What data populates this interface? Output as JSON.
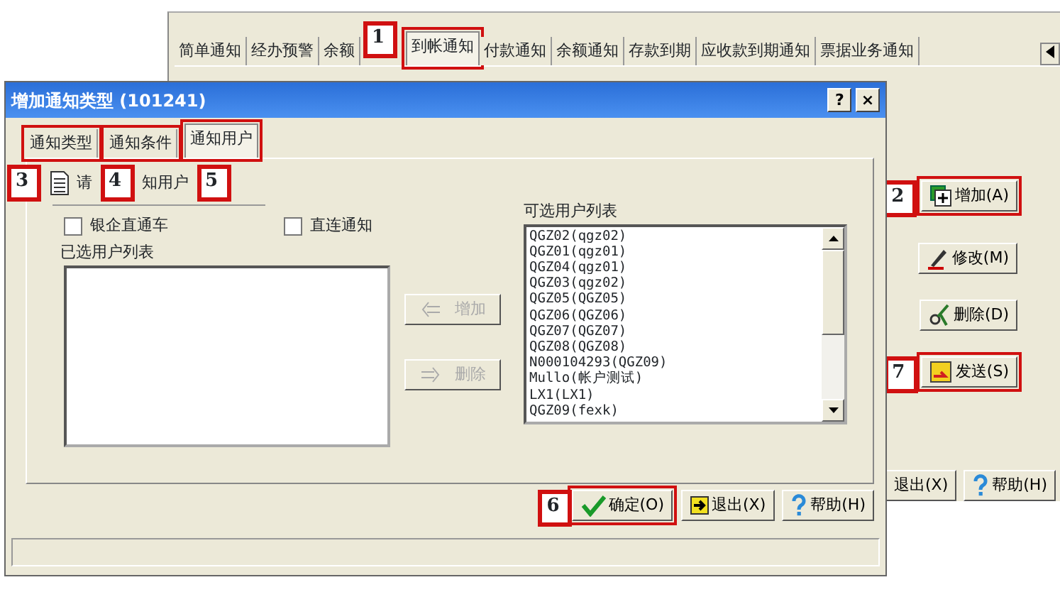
{
  "app": {
    "tabs": [
      {
        "label": "简单通知",
        "selected": false
      },
      {
        "label": "经办预警",
        "selected": false
      },
      {
        "label": "余额",
        "selected": false
      },
      {
        "label": "到帐通知",
        "selected": true,
        "callout": "1"
      },
      {
        "label": "付款通知",
        "selected": false
      },
      {
        "label": "余额通知",
        "selected": false
      },
      {
        "label": "存款到期",
        "selected": false
      },
      {
        "label": "应收款到期通知",
        "selected": false
      },
      {
        "label": "票据业务通知",
        "selected": false
      }
    ],
    "side_buttons": [
      {
        "label": "增加(A)",
        "kind": "add",
        "callout": "2"
      },
      {
        "label": "修改(M)",
        "kind": "edit"
      },
      {
        "label": "删除(D)",
        "kind": "cut"
      },
      {
        "label": "发送(S)",
        "kind": "send",
        "callout": "7"
      }
    ],
    "bottom_buttons": [
      {
        "label": "退出(X)",
        "kind": "none"
      },
      {
        "label": "帮助(H)",
        "kind": "help"
      }
    ]
  },
  "dialog": {
    "title": "增加通知类型 (101241)",
    "title_buttons": [
      "?",
      "×"
    ],
    "tabs": [
      {
        "label": "通知类型",
        "selected": false,
        "callout": "3"
      },
      {
        "label": "通知条件",
        "selected": false,
        "callout": "4"
      },
      {
        "label": "通知用户",
        "selected": true,
        "callout": "5"
      }
    ],
    "prompt": [
      "请",
      "知用户"
    ],
    "checkboxes": [
      {
        "label": "银企直通车",
        "checked": false
      },
      {
        "label": "直连通知",
        "checked": false
      }
    ],
    "selected_list_label": "已选用户列表",
    "available_list_label": "可选用户列表",
    "move_buttons": [
      {
        "label": "增加",
        "kind": "left",
        "disabled": true
      },
      {
        "label": "删除",
        "kind": "right",
        "disabled": true
      }
    ],
    "available_users": [
      "QGZ02(qgz02)",
      "QGZ01(qgz01)",
      "QGZ04(qgz01)",
      "QGZ03(qgz02)",
      "QGZ05(QGZ05)",
      "QGZ06(QGZ06)",
      "QGZ07(QGZ07)",
      "QGZ08(QGZ08)",
      "N000104293(QGZ09)",
      "Mullo(帐户测试)",
      "LX1(LX1)",
      "QGZ09(fexk)"
    ],
    "footer_buttons": [
      {
        "label": "确定(O)",
        "kind": "ok",
        "callout": "6"
      },
      {
        "label": "退出(X)",
        "kind": "exit"
      },
      {
        "label": "帮助(H)",
        "kind": "help"
      }
    ]
  }
}
